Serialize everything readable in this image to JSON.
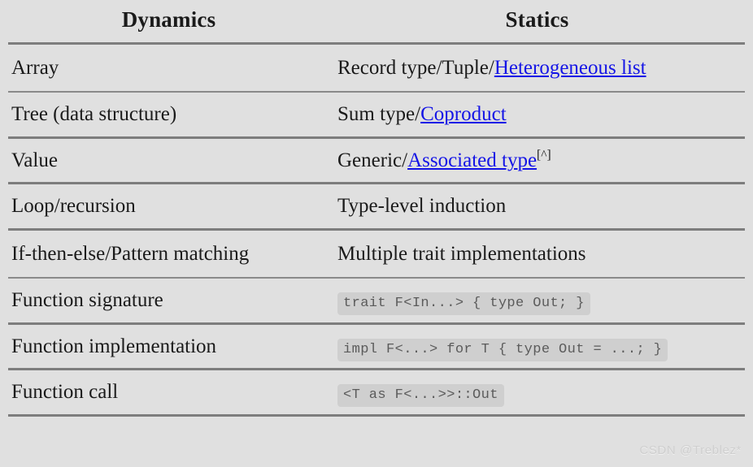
{
  "table": {
    "headers": {
      "dynamics": "Dynamics",
      "statics": "Statics"
    },
    "rows": [
      {
        "dynamics": "Array",
        "statics_prefix": "Record type/Tuple/",
        "statics_link": "Heterogeneous list",
        "statics_suffix": "",
        "statics_sup": "",
        "statics_code": ""
      },
      {
        "dynamics": "Tree (data structure)",
        "statics_prefix": "Sum type/",
        "statics_link": "Coproduct",
        "statics_suffix": "",
        "statics_sup": "",
        "statics_code": ""
      },
      {
        "dynamics": "Value",
        "statics_prefix": "Generic/",
        "statics_link": "Associated type",
        "statics_suffix": "",
        "statics_sup": "[^]",
        "statics_code": ""
      },
      {
        "dynamics": "Loop/recursion",
        "statics_prefix": "Type-level induction",
        "statics_link": "",
        "statics_suffix": "",
        "statics_sup": "",
        "statics_code": ""
      },
      {
        "dynamics": "If-then-else/Pattern matching",
        "statics_prefix": "Multiple trait implementations",
        "statics_link": "",
        "statics_suffix": "",
        "statics_sup": "",
        "statics_code": ""
      },
      {
        "dynamics": "Function signature",
        "statics_prefix": "",
        "statics_link": "",
        "statics_suffix": "",
        "statics_sup": "",
        "statics_code": "trait F<In...> { type Out; }"
      },
      {
        "dynamics": "Function implementation",
        "statics_prefix": "",
        "statics_link": "",
        "statics_suffix": "",
        "statics_sup": "",
        "statics_code": "impl F<...> for T { type Out = ...; }"
      },
      {
        "dynamics": "Function call",
        "statics_prefix": "",
        "statics_link": "",
        "statics_suffix": "",
        "statics_sup": "",
        "statics_code": "<T as F<...>>::Out"
      }
    ]
  },
  "watermark": {
    "text": "CSDN @Treblez*"
  },
  "colors": {
    "background": "#e0e0e0",
    "rule": "#7d7d7d",
    "link": "#1414e6",
    "code_bg": "#cfcfcf",
    "code_fg": "#5b5b5b",
    "text": "#1a1a1a",
    "watermark": "#cfcfcf"
  }
}
